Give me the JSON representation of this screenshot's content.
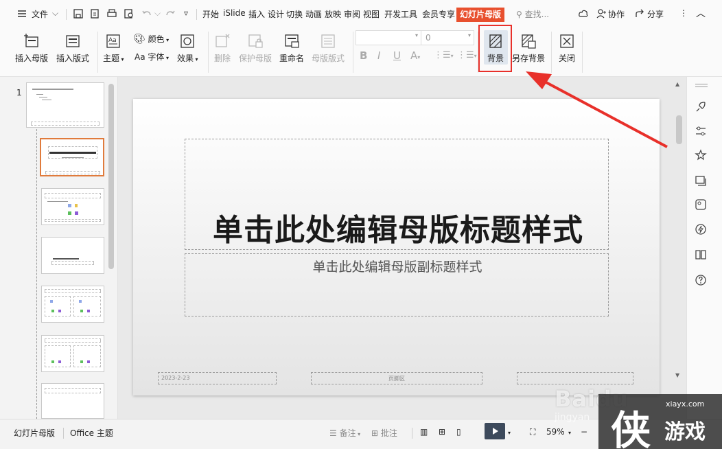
{
  "menubar": {
    "file_label": "文件",
    "tabs": [
      "开始",
      "iSlide",
      "插入",
      "设计",
      "切换",
      "动画",
      "放映",
      "审阅",
      "视图",
      "开发工具",
      "会员专享"
    ],
    "active_tab": "幻灯片母版",
    "search_placeholder": "查找...",
    "collab_label": "协作",
    "share_label": "分享"
  },
  "ribbon": {
    "insert_master": "插入母版",
    "insert_layout": "插入版式",
    "theme": "主题",
    "colors": "颜色",
    "fonts": "字体",
    "fonts_prefix": "Aa",
    "effects": "效果",
    "delete": "删除",
    "protect_master": "保护母版",
    "rename": "重命名",
    "master_layout": "母版版式",
    "font_size_value": "0",
    "background": "背景",
    "save_background": "另存背景",
    "close": "关闭"
  },
  "thumbnails": {
    "slide_number": "1",
    "layout_count": 7
  },
  "slide": {
    "title": "单击此处编辑母版标题样式",
    "subtitle": "单击此处编辑母版副标题样式",
    "date": "2023-2-23",
    "footer": "页脚区"
  },
  "statusbar": {
    "mode": "幻灯片母版",
    "theme": "Office 主题",
    "notes": "备注",
    "comments": "批注",
    "zoom": "59%"
  },
  "watermark": {
    "baidu": "Baidu",
    "jingyan": "jingyan",
    "site": "xiayx.com",
    "logo_char": "侠",
    "logo_text": "游戏"
  },
  "colors": {
    "accent_tab": "#e8502e",
    "highlight": "#e8302a",
    "selected_thumb": "#e07b3c"
  }
}
